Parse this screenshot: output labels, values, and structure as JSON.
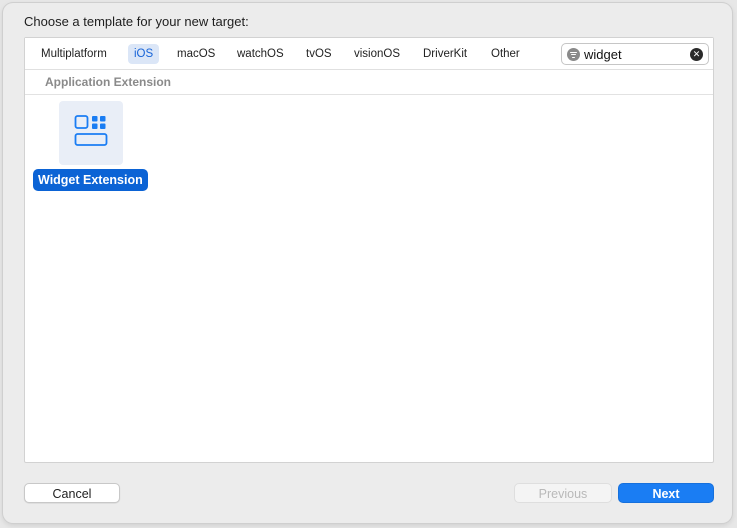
{
  "dialog": {
    "title": "Choose a template for your new target:"
  },
  "platform_tabs": [
    {
      "label": "Multiplatform",
      "active": false
    },
    {
      "label": "iOS",
      "active": true
    },
    {
      "label": "macOS",
      "active": false
    },
    {
      "label": "watchOS",
      "active": false
    },
    {
      "label": "tvOS",
      "active": false
    },
    {
      "label": "visionOS",
      "active": false
    },
    {
      "label": "DriverKit",
      "active": false
    },
    {
      "label": "Other",
      "active": false
    }
  ],
  "search": {
    "value": "widget",
    "filter_icon": "filter-circle-icon",
    "clear_icon": "clear-circle-icon"
  },
  "section": {
    "title": "Application Extension"
  },
  "templates": [
    {
      "label": "Widget Extension",
      "icon": "widget-extension-icon",
      "selected": true
    }
  ],
  "buttons": {
    "cancel": "Cancel",
    "previous": "Previous",
    "next": "Next"
  },
  "colors": {
    "accent": "#1a7df3",
    "selection": "#0b63d5",
    "active_tab_bg": "#dbe6f7",
    "active_tab_text": "#1764d8"
  }
}
